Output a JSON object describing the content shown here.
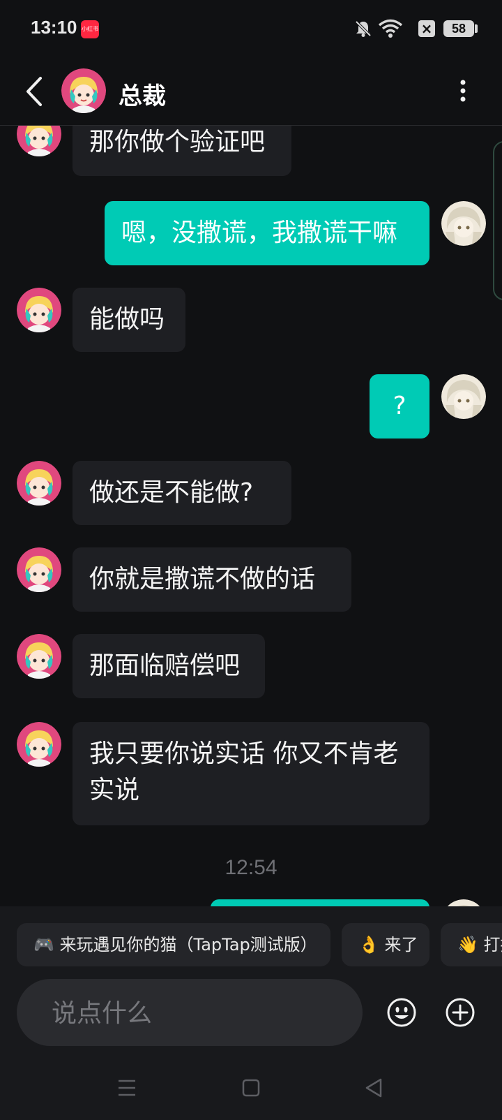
{
  "status_bar": {
    "time": "13:10",
    "app_badge": "小红书",
    "battery": "58",
    "sim": "×",
    "icons": [
      "bell-muted-icon",
      "wifi-icon",
      "sim-off-icon",
      "battery-icon"
    ]
  },
  "header": {
    "title": "总裁"
  },
  "messages": [
    {
      "side": "in",
      "text": "那你做个验证吧"
    },
    {
      "side": "out",
      "text": "嗯，没撒谎，我撒谎干嘛"
    },
    {
      "side": "in",
      "text": "能做吗"
    },
    {
      "side": "out",
      "text": "?"
    },
    {
      "side": "in",
      "text": "做还是不能做?"
    },
    {
      "side": "in",
      "text": "你就是撒谎不做的话"
    },
    {
      "side": "in",
      "text": "那面临赔偿吧"
    },
    {
      "side": "in",
      "text": "我只要你说实话 你又不肯老实说"
    }
  ],
  "time_separator": "12:54",
  "quick_replies": [
    {
      "icon": "gamepad-icon",
      "emoji": "🎮",
      "label": "来玩遇见你的猫（TapTap测试版）"
    },
    {
      "icon": "ok-hand-icon",
      "emoji": "👌",
      "label": "来了"
    },
    {
      "icon": "wave-icon",
      "emoji": "👋",
      "label": "打招呼"
    }
  ],
  "input": {
    "placeholder": "说点什么",
    "value": ""
  },
  "colors": {
    "background": "#101113",
    "outgoing_bubble": "#00cbb5",
    "incoming_bubble": "#1e1f23",
    "panel": "#18191c"
  }
}
